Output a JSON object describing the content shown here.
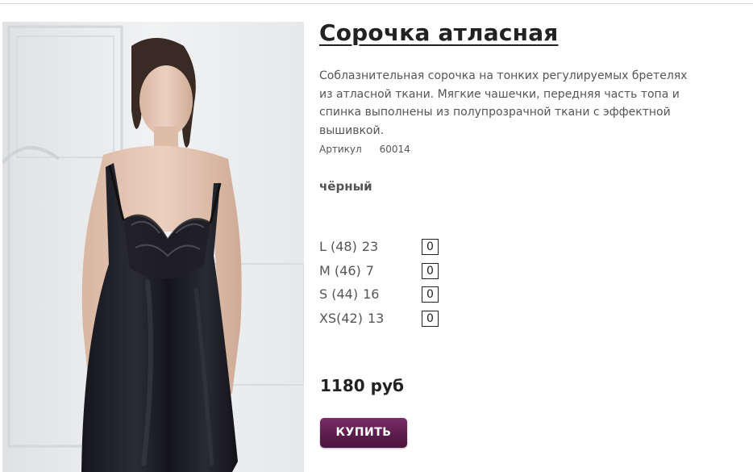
{
  "product": {
    "title": "Сорочка атласная",
    "description": "Соблазнительная сорочка на тонких регулируемых бретелях из атласной ткани. Мягкие чашечки, передняя часть топа и спинка выполнены из полупрозрачной ткани с эффектной вышивкой.",
    "article_label": "Артикул",
    "article_value": "60014",
    "color": "чёрный",
    "sizes": [
      {
        "label": "L (48)",
        "stock": "23",
        "quantity": "0"
      },
      {
        "label": "M (46)",
        "stock": "7",
        "quantity": "0"
      },
      {
        "label": "S (44)",
        "stock": "16",
        "quantity": "0"
      },
      {
        "label": "XS(42)",
        "stock": "13",
        "quantity": "0"
      }
    ],
    "price": "1180 руб",
    "buy_label": "КУПИТЬ"
  },
  "colors": {
    "buy_button": "#5c1d4d",
    "text": "#555555",
    "title": "#222222"
  },
  "icons": {
    "product_photo": "product-photo-model-black-satin-nightgown"
  }
}
